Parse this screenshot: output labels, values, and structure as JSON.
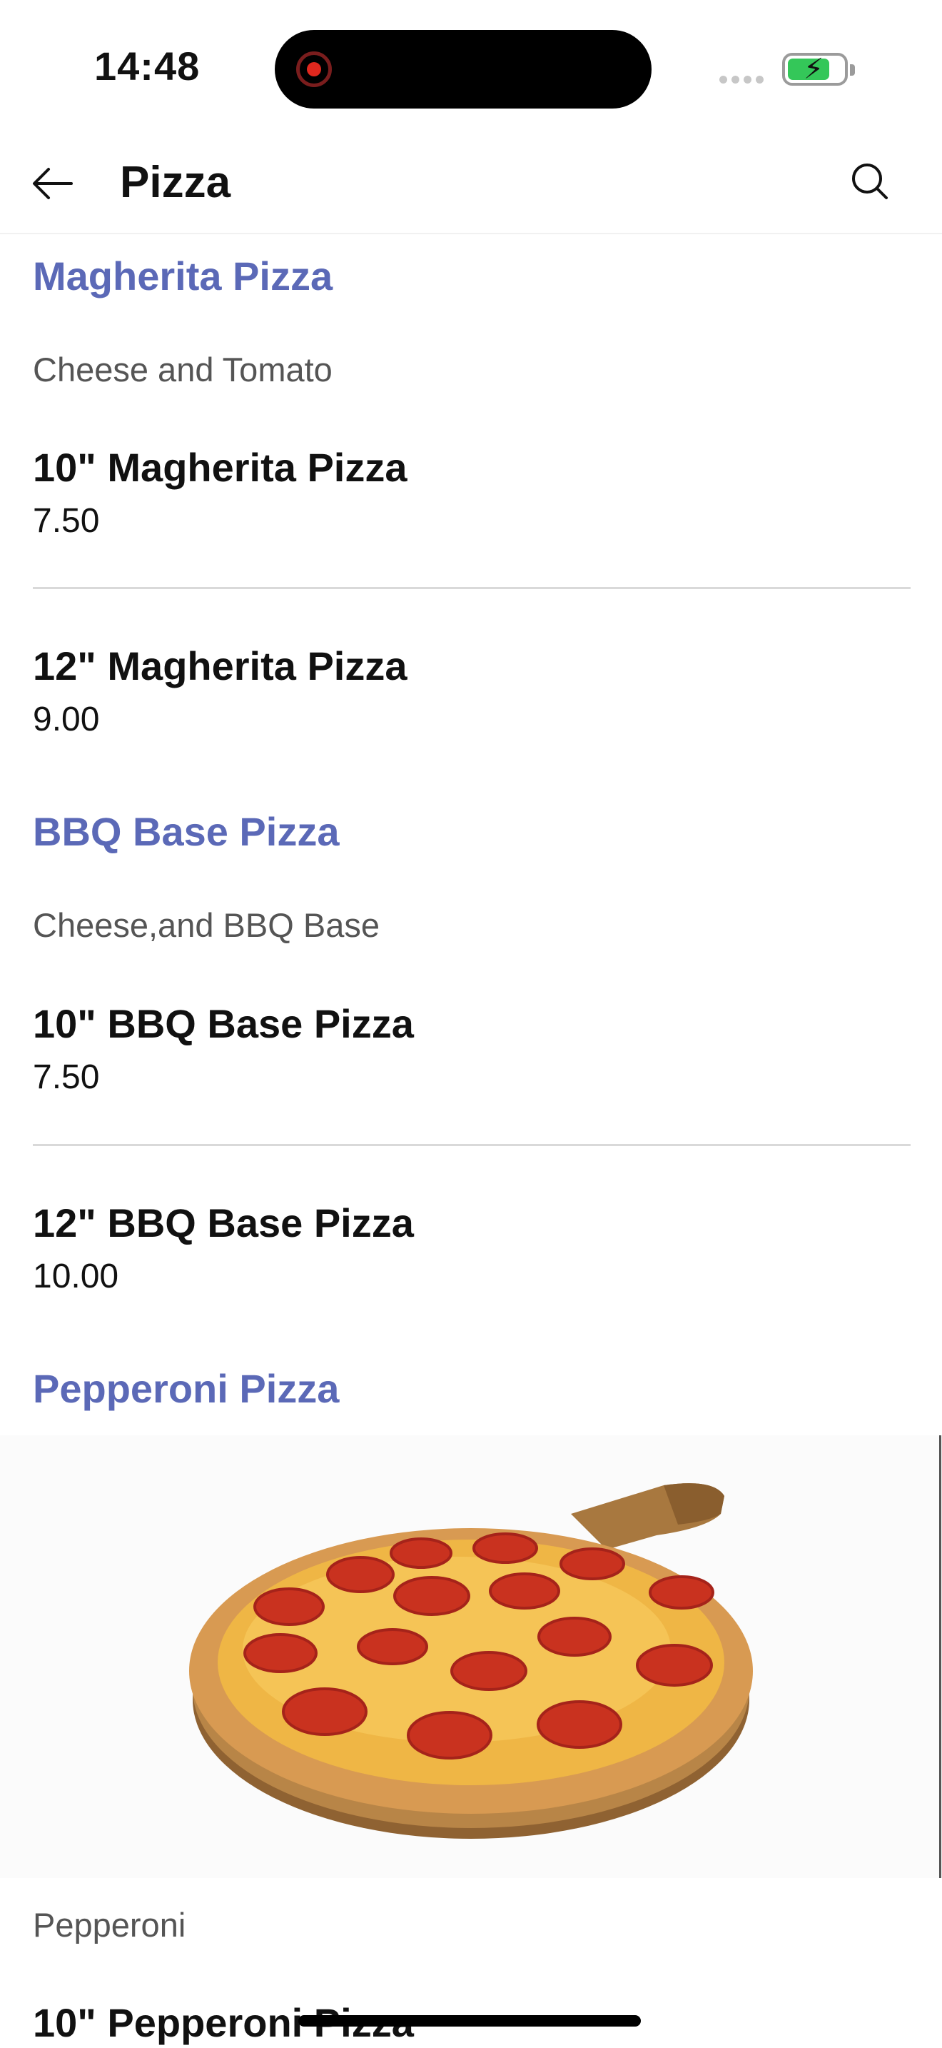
{
  "status_bar": {
    "time": "14:48",
    "recording_indicator": "screen-recording-icon",
    "battery_icon": "battery-charging-icon",
    "battery_color": "#34c759"
  },
  "header": {
    "title": "Pizza",
    "back_icon": "arrow-left-icon",
    "search_icon": "search-icon"
  },
  "accent_color": "#5b69b7",
  "sections": [
    {
      "title": "Magherita Pizza",
      "description": "Cheese and Tomato",
      "items": [
        {
          "name": "10\" Magherita Pizza",
          "price": "7.50"
        },
        {
          "name": "12\" Magherita Pizza",
          "price": "9.00"
        }
      ]
    },
    {
      "title": "BBQ Base Pizza",
      "description": "Cheese,and BBQ Base",
      "items": [
        {
          "name": "10\" BBQ Base Pizza",
          "price": "7.50"
        },
        {
          "name": "12\" BBQ Base Pizza",
          "price": "10.00"
        }
      ]
    },
    {
      "title": "Pepperoni Pizza",
      "image": "pepperoni-pizza-photo",
      "description": "Pepperoni",
      "items": [
        {
          "name": "10\" Pepperoni Pizza"
        }
      ]
    }
  ]
}
